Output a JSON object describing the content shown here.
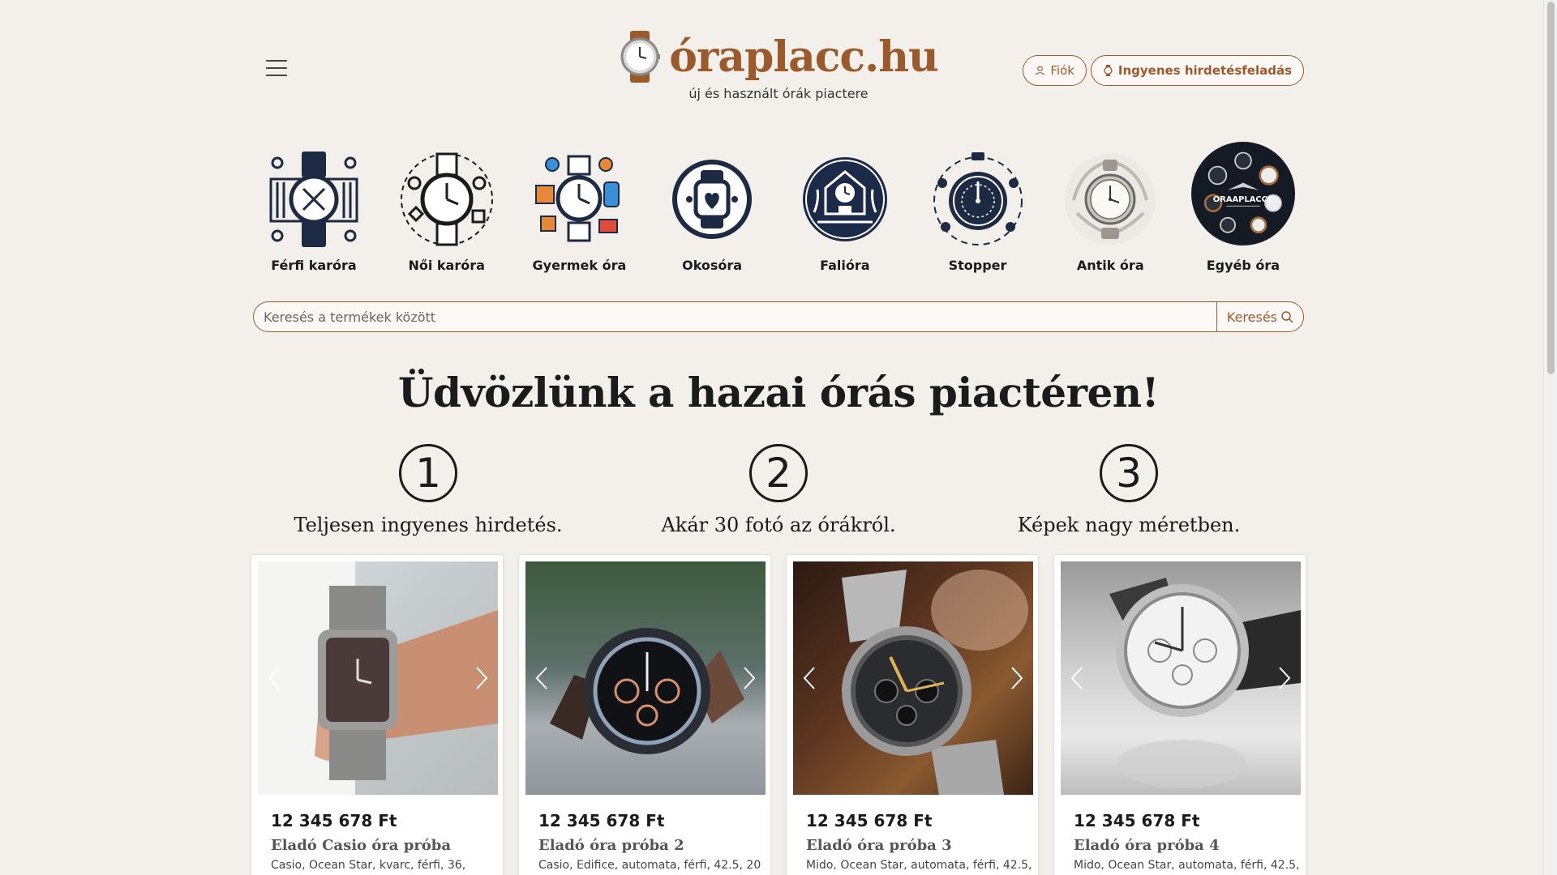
{
  "header": {
    "site_name": "óraplacc.hu",
    "tagline": "új és használt órák piactere",
    "account_label": "Fiók",
    "post_ad_label": "Ingyenes hirdetésfeladás"
  },
  "categories": [
    {
      "label": "Férfi karóra",
      "icon": "mens-watch-icon"
    },
    {
      "label": "Női karóra",
      "icon": "womens-watch-icon"
    },
    {
      "label": "Gyermek óra",
      "icon": "kids-watch-icon"
    },
    {
      "label": "Okosóra",
      "icon": "smartwatch-icon"
    },
    {
      "label": "Falióra",
      "icon": "wall-clock-icon"
    },
    {
      "label": "Stopper",
      "icon": "stopwatch-icon"
    },
    {
      "label": "Antik óra",
      "icon": "antique-watch-icon"
    },
    {
      "label": "Egyéb óra",
      "icon": "other-watch-icon",
      "logo_text": "ORAAPLACCC"
    }
  ],
  "search": {
    "placeholder": "Keresés a termékek között",
    "button_label": "Keresés"
  },
  "welcome": {
    "title": "Üdvözlünk a hazai órás piactéren!",
    "steps": [
      {
        "number": "1",
        "text": "Teljesen ingyenes hirdetés."
      },
      {
        "number": "2",
        "text": "Akár 30 fotó az órákról."
      },
      {
        "number": "3",
        "text": "Képek nagy méretben."
      }
    ]
  },
  "listings": [
    {
      "price": "12 345 678 Ft",
      "title": "Eladó Casio óra próba",
      "meta": "Casio, Ocean Star, kvarc, férfi, 36,"
    },
    {
      "price": "12 345 678 Ft",
      "title": "Eladó óra próba 2",
      "meta": "Casio, Edifice, automata, férfi, 42.5, 20"
    },
    {
      "price": "12 345 678 Ft",
      "title": "Eladó óra próba 3",
      "meta": "Mido, Ocean Star, automata, férfi, 42.5,"
    },
    {
      "price": "12 345 678 Ft",
      "title": "Eladó óra próba 4",
      "meta": "Mido, Ocean Star, automata, férfi, 42.5,"
    }
  ],
  "colors": {
    "brand": "#9b5a2b",
    "background": "#f3efeb"
  }
}
